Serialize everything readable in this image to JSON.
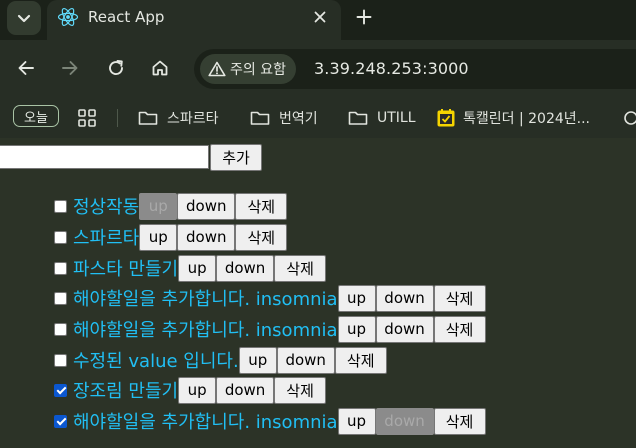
{
  "browser": {
    "tab": {
      "title": "React App"
    },
    "omnibox": {
      "security_label": "주의 요함",
      "url": "3.39.248.253:3000"
    },
    "bookmarks": {
      "today_label": "오늘",
      "items": [
        {
          "label": "스파르타",
          "icon": "folder-icon"
        },
        {
          "label": "번역기",
          "icon": "folder-icon"
        },
        {
          "label": "UTILL",
          "icon": "folder-icon"
        },
        {
          "label": "톡캘린더 | 2024년...",
          "icon": "calendar-icon"
        }
      ]
    },
    "colors": {
      "frame": "#1b2119",
      "toolbar": "#272e25",
      "page": "#2c3327",
      "accent": "#21bff4"
    }
  },
  "app": {
    "input": {
      "value": "",
      "placeholder": ""
    },
    "add_button_label": "추가",
    "button_labels": {
      "up": "up",
      "down": "down",
      "delete": "삭제"
    },
    "todos": [
      {
        "text": "정상작동",
        "checked": false,
        "up_disabled": true,
        "down_disabled": false
      },
      {
        "text": "스파르타",
        "checked": false,
        "up_disabled": false,
        "down_disabled": false
      },
      {
        "text": "파스타 만들기",
        "checked": false,
        "up_disabled": false,
        "down_disabled": false
      },
      {
        "text": "해야할일을 추가합니다. insomnia",
        "checked": false,
        "up_disabled": false,
        "down_disabled": false
      },
      {
        "text": "해야할일을 추가합니다. insomnia",
        "checked": false,
        "up_disabled": false,
        "down_disabled": false
      },
      {
        "text": "수정된 value 입니다.",
        "checked": false,
        "up_disabled": false,
        "down_disabled": false
      },
      {
        "text": "장조림 만들기",
        "checked": true,
        "up_disabled": false,
        "down_disabled": false
      },
      {
        "text": "해야할일을 추가합니다. insomnia",
        "checked": true,
        "up_disabled": false,
        "down_disabled": true
      }
    ]
  }
}
